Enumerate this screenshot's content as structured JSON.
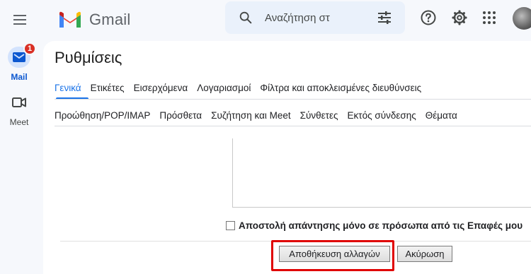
{
  "header": {
    "app_name": "Gmail",
    "search": {
      "placeholder": "Αναζήτηση στ"
    },
    "icons": [
      "menu-icon",
      "gmail-logo-icon",
      "search-icon",
      "tune-icon",
      "help-icon",
      "gear-icon",
      "apps-grid-icon",
      "avatar"
    ]
  },
  "rail": {
    "items": [
      {
        "label": "Mail",
        "badge": "1",
        "icon": "mail-icon",
        "active": true
      },
      {
        "label": "Meet",
        "icon": "video-camera-icon",
        "active": false
      }
    ]
  },
  "settings": {
    "title": "Ρυθμίσεις",
    "tabs_row1": [
      "Γενικά",
      "Ετικέτες",
      "Εισερχόμενα",
      "Λογαριασμοί",
      "Φίλτρα και αποκλεισμένες διευθύνσεις"
    ],
    "tabs_row2": [
      "Προώθηση/POP/IMAP",
      "Πρόσθετα",
      "Συζήτηση και Meet",
      "Σύνθετες",
      "Εκτός σύνδεσης",
      "Θέματα"
    ],
    "active_tab": "Γενικά",
    "contacts_only_label": "Αποστολή απάντησης μόνο σε πρόσωπα από τις Επαφές μου",
    "contacts_only_checked": false,
    "save_label": "Αποθήκευση αλλαγών",
    "cancel_label": "Ακύρωση"
  },
  "colors": {
    "accent": "#1a73e8",
    "badge": "#d93025",
    "highlight": "#e00000",
    "background": "#f6f8fc"
  }
}
